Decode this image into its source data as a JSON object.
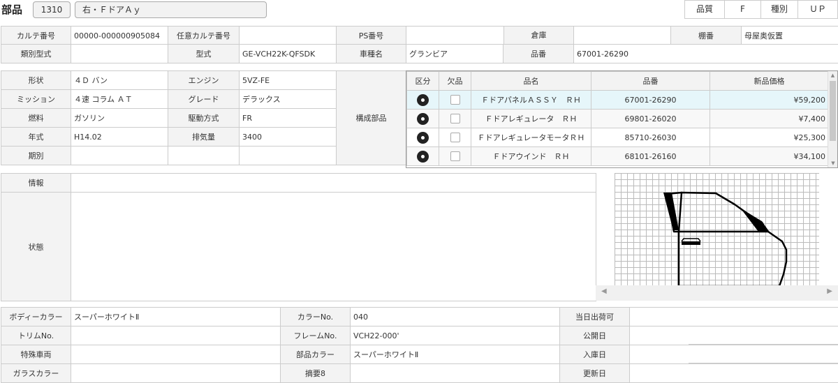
{
  "header": {
    "title": "部品",
    "code": "1310",
    "part_label": "右・ＦドアＡｙ",
    "quality_label": "品質",
    "quality_value": "F",
    "type_label": "種別",
    "type_value": "ＵＰ"
  },
  "row1": {
    "karte_label": "カルテ番号",
    "karte_value": "00000-000000905084",
    "nini_label": "任意カルテ番号",
    "nini_value": "",
    "ps_label": "PS番号",
    "ps_value": "",
    "souko_label": "倉庫",
    "souko_value": "",
    "tana_label": "棚番",
    "tana_value": "母屋奥仮置"
  },
  "row2": {
    "ruibetsu_label": "類別型式",
    "ruibetsu_value": "",
    "katashiki_label": "型式",
    "katashiki_value": "GE-VCH22K-QFSDK",
    "shamei_label": "車種名",
    "shamei_value": "グランビア",
    "hinban_label": "品番",
    "hinban_value": "67001-26290"
  },
  "specs": {
    "shape_label": "形状",
    "shape_value": "４Ｄ バン",
    "engine_label": "エンジン",
    "engine_value": "5VZ-FE",
    "mission_label": "ミッション",
    "mission_value": "４速 コラム ＡＴ",
    "grade_label": "グレード",
    "grade_value": "デラックス",
    "fuel_label": "燃料",
    "fuel_value": "ガソリン",
    "drive_label": "駆動方式",
    "drive_value": "FR",
    "year_label": "年式",
    "year_value": "H14.02",
    "displacement_label": "排気量",
    "displacement_value": "3400",
    "period_label": "期別",
    "period_value": "",
    "components_label": "構成部品"
  },
  "parts_table": {
    "headers": [
      "区分",
      "欠品",
      "品名",
      "品番",
      "新品価格"
    ],
    "rows": [
      {
        "name": "ＦドアパネルＡＳＳＹ　ＲＨ",
        "number": "67001-26290",
        "price": "¥59,200"
      },
      {
        "name": "Ｆドアレギュレータ　ＲＨ",
        "number": "69801-26020",
        "price": "¥7,400"
      },
      {
        "name": "ＦドアレギュレータモータＲＨ",
        "number": "85710-26030",
        "price": "¥25,300"
      },
      {
        "name": "Ｆドアウインド　ＲＨ",
        "number": "68101-26160",
        "price": "¥34,100"
      }
    ]
  },
  "info": {
    "info_label": "情報",
    "info_value": "",
    "state_label": "状態",
    "state_value": ""
  },
  "bottom": {
    "body_color_label": "ボディーカラー",
    "body_color_value": "スーパーホワイトⅡ",
    "color_no_label": "カラーNo.",
    "color_no_value": "040",
    "shipping_label": "当日出荷可",
    "shipping_value": "",
    "trim_label": "トリムNo.",
    "trim_value": "",
    "frame_label": "フレームNo.",
    "frame_value": "VCH22-000'",
    "public_label": "公開日",
    "public_value": "",
    "special_label": "特殊車両",
    "special_value": "",
    "part_color_label": "部品カラー",
    "part_color_value": "スーパーホワイトⅡ",
    "stock_label": "入庫日",
    "stock_value": "",
    "glass_label": "ガラスカラー",
    "glass_value": "",
    "summary_label": "摘要8",
    "summary_value": "",
    "update_label": "更新日",
    "update_value": ""
  },
  "icons": {
    "kubun": "disc-icon",
    "scroll_left": "arrow-left-icon",
    "scroll_right": "arrow-right-icon",
    "scroll_up": "arrow-up-icon",
    "scroll_down": "arrow-down-icon"
  },
  "colors": {
    "highlight_row": "#e6f6fa",
    "label_bg": "#f3f3f3",
    "border": "#cccccc"
  }
}
